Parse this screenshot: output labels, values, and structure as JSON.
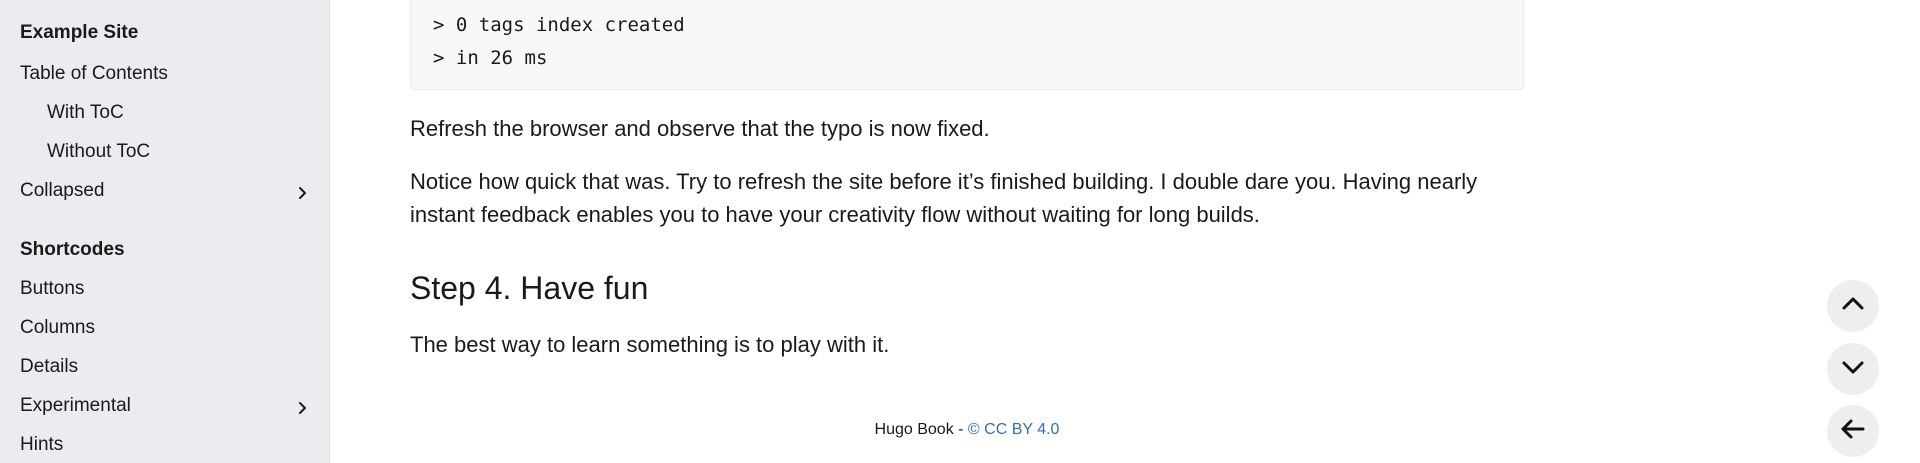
{
  "sidebar": {
    "site_title": "Example Site",
    "items": [
      {
        "label": "Table of Contents"
      },
      {
        "label": "With ToC"
      },
      {
        "label": "Without ToC"
      },
      {
        "label": "Collapsed"
      }
    ],
    "shortcodes_title": "Shortcodes",
    "shortcodes": [
      {
        "label": "Buttons"
      },
      {
        "label": "Columns"
      },
      {
        "label": "Details"
      },
      {
        "label": "Experimental"
      },
      {
        "label": "Hints"
      }
    ],
    "background": "#ececf0"
  },
  "main": {
    "code_lines": [
      "> 0 tags index created",
      "> in 26 ms"
    ],
    "para_refresh": "Refresh the browser and observe that the typo is now fixed.",
    "para_notice": "Notice how quick that was. Try to refresh the site before it’s finished building. I double dare you. Having nearly instant feedback enables you to have your creativity flow without waiting for long builds.",
    "heading_step4": "Step 4. Have fun",
    "para_best": "The best way to learn something is to play with it."
  },
  "footer": {
    "text": "Hugo Book - ",
    "link": "© CC BY 4.0",
    "link_color": "#2e6fb5"
  },
  "float_buttons": {
    "up": "chevron-up-icon",
    "down": "chevron-down-icon",
    "back": "arrow-left-icon"
  }
}
